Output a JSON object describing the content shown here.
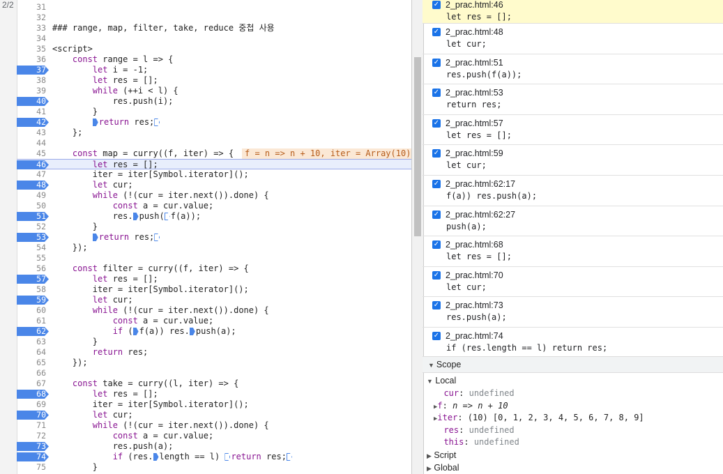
{
  "tab_indicator": "2/2",
  "code_lines": [
    {
      "n": "31",
      "t": ""
    },
    {
      "n": "32",
      "t": ""
    },
    {
      "n": "33",
      "t": "### range, map, filter, take, reduce 중첩 사용"
    },
    {
      "n": "34",
      "t": ""
    },
    {
      "n": "35",
      "t": "<script>"
    },
    {
      "n": "36",
      "t": "    const range = l => {"
    },
    {
      "n": "37",
      "t": "        let i = -1;",
      "bp": true
    },
    {
      "n": "38",
      "t": "        let res = [];"
    },
    {
      "n": "39",
      "t": "        while (++i < l) {"
    },
    {
      "n": "40",
      "t": "            res.push(i);",
      "bp": true
    },
    {
      "n": "41",
      "t": "        }"
    },
    {
      "n": "42",
      "t": "        ▶return res;▷",
      "bp": true
    },
    {
      "n": "43",
      "t": "    };"
    },
    {
      "n": "44",
      "t": ""
    },
    {
      "n": "45",
      "t": "    const map = curry((f, iter) => {"
    },
    {
      "n": "46",
      "t": "        let res = [];",
      "bp": true,
      "active": true
    },
    {
      "n": "47",
      "t": "        iter = iter[Symbol.iterator]();"
    },
    {
      "n": "48",
      "t": "        let cur;",
      "bp": true
    },
    {
      "n": "49",
      "t": "        while (!(cur = iter.next()).done) {"
    },
    {
      "n": "50",
      "t": "            const a = cur.value;"
    },
    {
      "n": "51",
      "t": "            res.▶push(▷f(a));",
      "bp": true
    },
    {
      "n": "52",
      "t": "        }"
    },
    {
      "n": "53",
      "t": "        ▶return res;▷",
      "bp": true
    },
    {
      "n": "54",
      "t": "    });"
    },
    {
      "n": "55",
      "t": ""
    },
    {
      "n": "56",
      "t": "    const filter = curry((f, iter) => {"
    },
    {
      "n": "57",
      "t": "        let res = [];",
      "bp": true
    },
    {
      "n": "58",
      "t": "        iter = iter[Symbol.iterator]();"
    },
    {
      "n": "59",
      "t": "        let cur;",
      "bp": true
    },
    {
      "n": "60",
      "t": "        while (!(cur = iter.next()).done) {"
    },
    {
      "n": "61",
      "t": "            const a = cur.value;"
    },
    {
      "n": "62",
      "t": "            if (▶f(a)) res.▶push(a);",
      "bp": true
    },
    {
      "n": "63",
      "t": "        }"
    },
    {
      "n": "64",
      "t": "        return res;"
    },
    {
      "n": "65",
      "t": "    });"
    },
    {
      "n": "66",
      "t": ""
    },
    {
      "n": "67",
      "t": "    const take = curry((l, iter) => {"
    },
    {
      "n": "68",
      "t": "        let res = [];",
      "bp": true
    },
    {
      "n": "69",
      "t": "        iter = iter[Symbol.iterator]();"
    },
    {
      "n": "70",
      "t": "        let cur;",
      "bp": true
    },
    {
      "n": "71",
      "t": "        while (!(cur = iter.next()).done) {"
    },
    {
      "n": "72",
      "t": "            const a = cur.value;"
    },
    {
      "n": "73",
      "t": "            res.push(a);",
      "bp": true
    },
    {
      "n": "74",
      "t": "            if (res.▶length == l) ▷return res;▷",
      "bp": true
    },
    {
      "n": "75",
      "t": "        }"
    }
  ],
  "inline_value": "f = n => n + 10, iter = Array(10)",
  "breakpoints": [
    {
      "loc": "2_prac.html:46",
      "code": "let res = [];",
      "highlight": true
    },
    {
      "loc": "2_prac.html:48",
      "code": "let cur;"
    },
    {
      "loc": "2_prac.html:51",
      "code": "res.push(f(a));"
    },
    {
      "loc": "2_prac.html:53",
      "code": "return res;"
    },
    {
      "loc": "2_prac.html:57",
      "code": "let res = [];"
    },
    {
      "loc": "2_prac.html:59",
      "code": "let cur;"
    },
    {
      "loc": "2_prac.html:62:17",
      "code": "f(a)) res.push(a);"
    },
    {
      "loc": "2_prac.html:62:27",
      "code": "push(a);"
    },
    {
      "loc": "2_prac.html:68",
      "code": "let res = [];"
    },
    {
      "loc": "2_prac.html:70",
      "code": "let cur;"
    },
    {
      "loc": "2_prac.html:73",
      "code": "res.push(a);"
    },
    {
      "loc": "2_prac.html:74",
      "code": "if (res.length == l) return res;"
    }
  ],
  "scope": {
    "title": "Scope",
    "local_label": "Local",
    "vars": [
      {
        "name": "cur",
        "value": "undefined"
      },
      {
        "name": "f",
        "value": "n => n + 10",
        "expandable": true
      },
      {
        "name": "iter",
        "value": "(10) [0, 1, 2, 3, 4, 5, 6, 7, 8, 9]",
        "expandable": true
      },
      {
        "name": "res",
        "value": "undefined"
      },
      {
        "name": "this",
        "value": "undefined"
      }
    ],
    "script_label": "Script",
    "global_label": "Global"
  }
}
